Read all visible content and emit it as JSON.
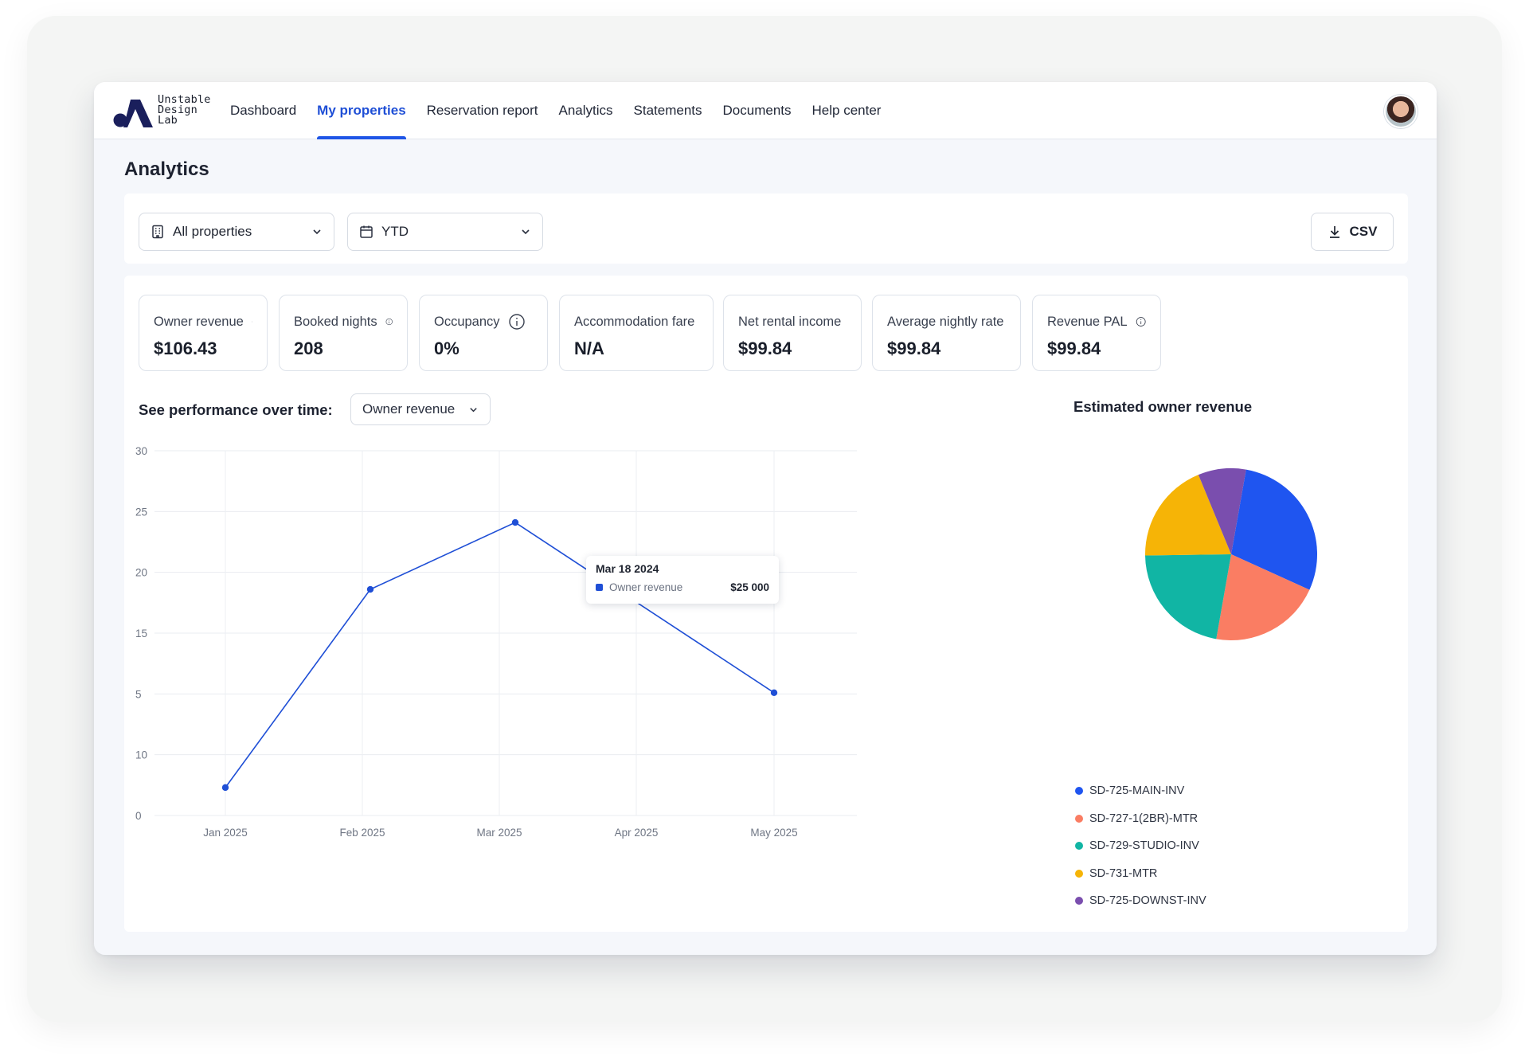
{
  "brand": {
    "logo_text": "Unstable\nDesign\nLab"
  },
  "nav": {
    "items": [
      {
        "label": "Dashboard",
        "active": false
      },
      {
        "label": "My properties",
        "active": true
      },
      {
        "label": "Reservation report",
        "active": false
      },
      {
        "label": "Analytics",
        "active": false
      },
      {
        "label": "Statements",
        "active": false
      },
      {
        "label": "Documents",
        "active": false
      },
      {
        "label": "Help center",
        "active": false
      }
    ]
  },
  "page": {
    "title": "Analytics"
  },
  "filters": {
    "property_select": {
      "value": "All properties",
      "icon": "building-icon"
    },
    "period_select": {
      "value": "YTD",
      "icon": "calendar-icon"
    },
    "csv_button": {
      "label": "CSV",
      "icon": "download-icon"
    }
  },
  "kpis": [
    {
      "label": "Owner revenue",
      "value": "$106.43"
    },
    {
      "label": "Booked nights",
      "value": "208"
    },
    {
      "label": "Occupancy",
      "value": "0%"
    },
    {
      "label": "Accommodation fare",
      "value": "N/A"
    },
    {
      "label": "Net rental income",
      "value": "$99.84"
    },
    {
      "label": "Average nightly rate",
      "value": "$99.84"
    },
    {
      "label": "Revenue PAL",
      "value": "$99.84"
    }
  ],
  "performance": {
    "label": "See performance over time:",
    "metric_select": "Owner revenue"
  },
  "chart_data": [
    {
      "type": "line",
      "x": [
        "Jan 2025",
        "Feb 2025",
        "Mar 2025",
        "Apr 2025",
        "May 2025"
      ],
      "y_tick_labels": [
        "30",
        "25",
        "20",
        "15",
        "5",
        "10",
        "0"
      ],
      "points": [
        {
          "x": "Jan 2025",
          "y": 2.3
        },
        {
          "x": "Feb 2025",
          "y": 18.6
        },
        {
          "x": "Mar 2025",
          "y": 24.1
        },
        {
          "x": "May 2025",
          "y": 10.1
        }
      ],
      "line_color": "#1f4fd6",
      "grid": true,
      "tooltip": {
        "date": "Mar 18 2024",
        "series": "Owner revenue",
        "value": "$25 000"
      }
    },
    {
      "type": "pie",
      "title": "Estimated owner revenue",
      "slices": [
        {
          "label": "SD-725-MAIN-INV",
          "value": 29,
          "color": "#1f55f0"
        },
        {
          "label": "SD-727-1(2BR)-MTR",
          "value": 21,
          "color": "#fa7d63"
        },
        {
          "label": "SD-729-STUDIO-INV",
          "value": 22,
          "color": "#11b5a4"
        },
        {
          "label": "SD-731-MTR",
          "value": 19,
          "color": "#f6b406"
        },
        {
          "label": "SD-725-DOWNST-INV",
          "value": 9,
          "color": "#7a4eae"
        }
      ],
      "legend_position": "bottom-left"
    }
  ]
}
